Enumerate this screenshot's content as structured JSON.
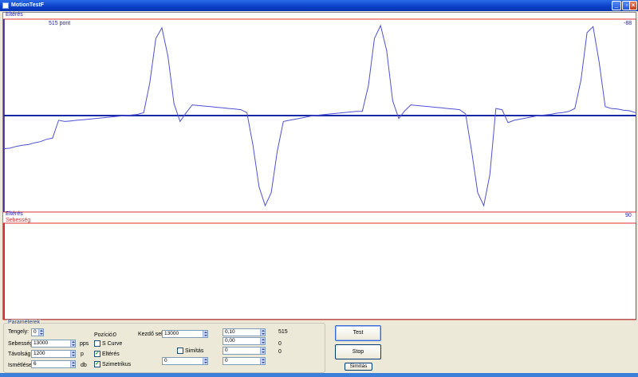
{
  "window": {
    "title": "MotionTestF"
  },
  "upper_plot": {
    "top_label": "Eltérés",
    "points_label": "515 pont",
    "value_label": "-88",
    "bottom_label": "Eltérés",
    "trace_color": "#5050D8",
    "baseline_color": "#1428A8",
    "border_color": "#D83030",
    "trace_values": [
      -5.6,
      -5.5,
      -5.2,
      -5.0,
      -4.9,
      -4.6,
      -4.4,
      -4.0,
      -3.8,
      -0.8,
      -1.0,
      -0.9,
      -0.8,
      -0.7,
      -0.6,
      -0.5,
      -0.4,
      -0.3,
      -0.2,
      -0.1,
      0.0,
      0.1,
      0.2,
      0.5,
      5.5,
      13.0,
      14.8,
      10.0,
      2.0,
      -1.0,
      0.5,
      1.8,
      1.7,
      1.6,
      1.5,
      1.4,
      1.3,
      1.2,
      1.1,
      1.0,
      0.5,
      -5.0,
      -12.0,
      -15.2,
      -13.0,
      -6.0,
      -1.0,
      -0.8,
      -0.6,
      -0.4,
      -0.2,
      0.0,
      0.1,
      0.2,
      0.3,
      0.4,
      0.5,
      0.6,
      0.7,
      0.7,
      5.0,
      13.0,
      15.2,
      11.0,
      2.5,
      -0.5,
      0.8,
      1.8,
      1.7,
      1.6,
      1.5,
      1.4,
      1.3,
      1.2,
      1.1,
      1.0,
      0.3,
      -6.0,
      -13.0,
      -15.2,
      -10.0,
      1.2,
      1.0,
      -1.2,
      -0.8,
      -0.6,
      -0.4,
      -0.2,
      0.0,
      0.1,
      0.2,
      0.4,
      0.5,
      0.7,
      1.2,
      6.0,
      14.0,
      15.0,
      9.0,
      1.5,
      1.2,
      1.1,
      0.9,
      0.8,
      0.5
    ],
    "trace_range": [
      -16,
      16
    ]
  },
  "lower_plot": {
    "title": "Sebesség",
    "value_label": "90",
    "border_color": "#D83030"
  },
  "params": {
    "group_title": "Paraméterek",
    "tengely_label": "Tengely:",
    "tengely_value": "0",
    "sebesseg_label": "Sebesség:",
    "sebesseg_value": "13000",
    "sebesseg_unit": "pps",
    "tavolsag_label": "Távolság:",
    "tavolsag_value": "1200",
    "tavolsag_unit": "p",
    "ismetlesek_label": "Ismétlések:",
    "ismetlesek_value": "6",
    "ismetlesek_unit": "db",
    "pozicio_label": "Pozíció:",
    "pozicio_value": "0",
    "scurve_label": "S Curve",
    "elteres_label": "Eltérés",
    "szimmetrikus_label": "Szimetrikus",
    "kezdo_label": "Kezdő seb.:",
    "kezdo_value": "13000",
    "simitas_label": "Simítás",
    "bottom_left_value": "0",
    "col3_values": [
      "0,10",
      "0,00",
      "0",
      "0"
    ],
    "col4_values": [
      "515",
      "0",
      "0"
    ]
  },
  "buttons": {
    "test": "Test",
    "stop": "Stop",
    "simitas": "Simítás"
  }
}
